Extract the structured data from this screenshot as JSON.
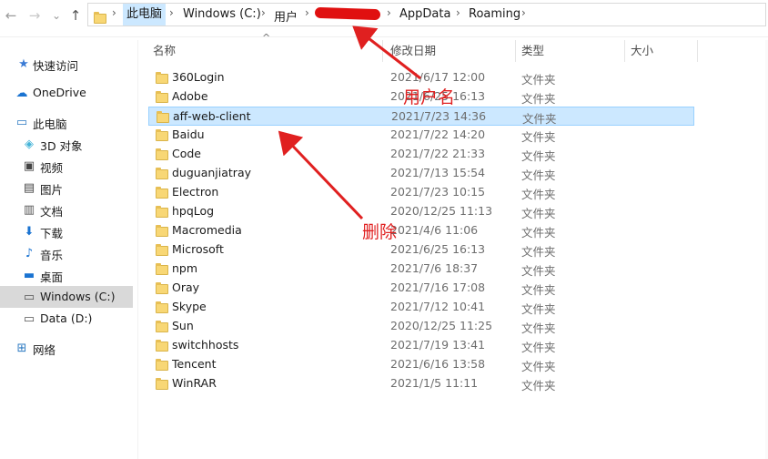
{
  "nav_buttons": {
    "back": "←",
    "forward": "→",
    "recent": "⌄",
    "up": "↑"
  },
  "breadcrumb": {
    "items": [
      "此电脑",
      "Windows (C:)",
      "用户",
      "AppData",
      "Roaming"
    ],
    "separator": "›"
  },
  "columns": {
    "name": "名称",
    "date": "修改日期",
    "type": "类型",
    "size": "大小"
  },
  "sidebar": {
    "items": [
      {
        "label": "快速访问",
        "icon": "star-icon"
      },
      {
        "label": "OneDrive",
        "icon": "cloud-icon"
      },
      {
        "label": "此电脑",
        "icon": "computer-icon"
      },
      {
        "label": "3D 对象",
        "icon": "cube-icon"
      },
      {
        "label": "视频",
        "icon": "video-icon"
      },
      {
        "label": "图片",
        "icon": "picture-icon"
      },
      {
        "label": "文档",
        "icon": "document-icon"
      },
      {
        "label": "下载",
        "icon": "download-icon"
      },
      {
        "label": "音乐",
        "icon": "music-icon"
      },
      {
        "label": "桌面",
        "icon": "desktop-icon"
      },
      {
        "label": "Windows (C:)",
        "icon": "drive-icon"
      },
      {
        "label": "Data (D:)",
        "icon": "drive-icon"
      },
      {
        "label": "网络",
        "icon": "network-icon"
      }
    ],
    "selected_index": 10
  },
  "files": [
    {
      "name": "360Login",
      "date": "2021/6/17 12:00",
      "type": "文件夹"
    },
    {
      "name": "Adobe",
      "date": "2021/6/25 16:13",
      "type": "文件夹"
    },
    {
      "name": "aff-web-client",
      "date": "2021/7/23 14:36",
      "type": "文件夹"
    },
    {
      "name": "Baidu",
      "date": "2021/7/22 14:20",
      "type": "文件夹"
    },
    {
      "name": "Code",
      "date": "2021/7/22 21:33",
      "type": "文件夹"
    },
    {
      "name": "duguanjiatray",
      "date": "2021/7/13 15:54",
      "type": "文件夹"
    },
    {
      "name": "Electron",
      "date": "2021/7/23 10:15",
      "type": "文件夹"
    },
    {
      "name": "hpqLog",
      "date": "2020/12/25 11:13",
      "type": "文件夹"
    },
    {
      "name": "Macromedia",
      "date": "2021/4/6 11:06",
      "type": "文件夹"
    },
    {
      "name": "Microsoft",
      "date": "2021/6/25 16:13",
      "type": "文件夹"
    },
    {
      "name": "npm",
      "date": "2021/7/6 18:37",
      "type": "文件夹"
    },
    {
      "name": "Oray",
      "date": "2021/7/16 17:08",
      "type": "文件夹"
    },
    {
      "name": "Skype",
      "date": "2021/7/12 10:41",
      "type": "文件夹"
    },
    {
      "name": "Sun",
      "date": "2020/12/25 11:25",
      "type": "文件夹"
    },
    {
      "name": "switchhosts",
      "date": "2021/7/19 13:41",
      "type": "文件夹"
    },
    {
      "name": "Tencent",
      "date": "2021/6/16 13:58",
      "type": "文件夹"
    },
    {
      "name": "WinRAR",
      "date": "2021/1/5 11:11",
      "type": "文件夹"
    }
  ],
  "selected_file_index": 2,
  "annotations": {
    "username_label": "用户名",
    "delete_label": "删除",
    "color": "#e02020"
  },
  "colors": {
    "selection_bg": "#cce8ff",
    "selection_border": "#99d1ff",
    "folder": "#f8d775"
  }
}
